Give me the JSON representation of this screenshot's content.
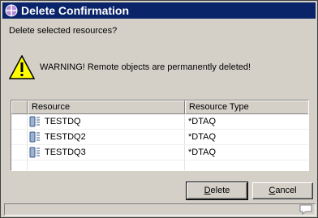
{
  "dialog": {
    "title": "Delete Confirmation",
    "question": "Delete selected resources?",
    "warning": "WARNING! Remote objects are permanently deleted!"
  },
  "table": {
    "columns": [
      "",
      "Resource",
      "Resource Type"
    ],
    "rows": [
      {
        "resource": "TESTDQ",
        "type": "*DTAQ"
      },
      {
        "resource": "TESTDQ2",
        "type": "*DTAQ"
      },
      {
        "resource": "TESTDQ3",
        "type": "*DTAQ"
      }
    ]
  },
  "buttons": {
    "delete": "Delete",
    "cancel": "Cancel"
  },
  "colors": {
    "titlebar": "#0a246a",
    "warning_yellow": "#ffff00"
  },
  "icons": {
    "title": "eclipse-sphere-icon",
    "warning": "warning-triangle-icon",
    "row": "data-queue-icon",
    "status": "speech-bubble-icon"
  }
}
